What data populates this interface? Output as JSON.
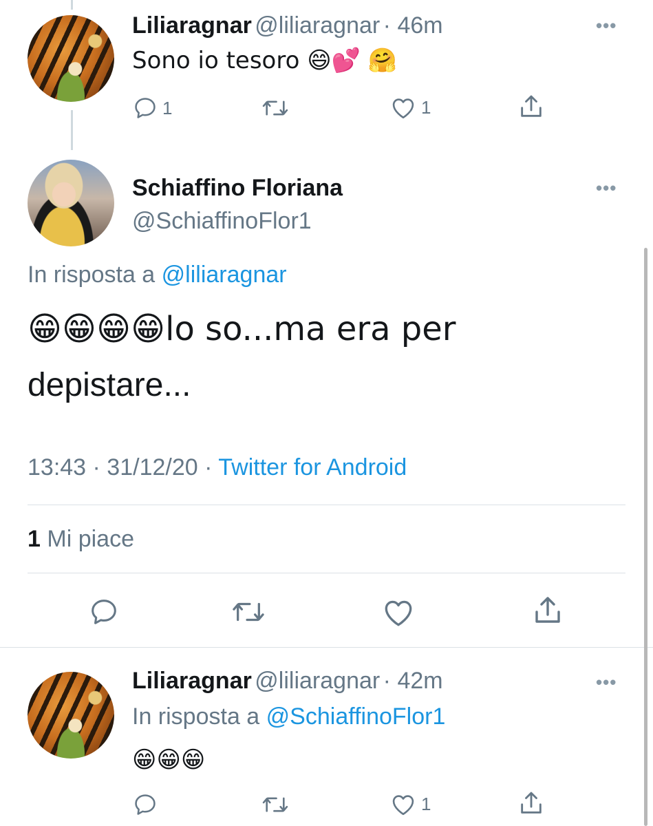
{
  "tweet1": {
    "name": "Liliaragnar",
    "handle": "@liliaragnar",
    "time": "· 46m",
    "text": "Sono io tesoro 😄💕 🤗",
    "replies": "1",
    "likes": "1"
  },
  "main": {
    "name": "Schiaffino Floriana",
    "handle": "@SchiaffinoFlor1",
    "reply_prefix": "In risposta a",
    "reply_to": "@liliaragnar",
    "text_line1": "😁😁😁😁lo so...ma era per",
    "text_line2": "depistare...",
    "time": "13:43 · 31/12/20 ·",
    "source": "Twitter for Android",
    "likes_count": "1",
    "likes_label": "Mi piace"
  },
  "tweet3": {
    "name": "Liliaragnar",
    "handle": "@liliaragnar",
    "time": "· 42m",
    "reply_prefix": "In risposta a",
    "reply_to": "@SchiaffinoFlor1",
    "text": "😁😁😁",
    "likes": "1"
  },
  "icons": {
    "reply": "reply-icon",
    "retweet": "retweet-icon",
    "like": "heart-icon",
    "share": "share-icon",
    "more": "more-icon"
  },
  "colors": {
    "link": "#1b95e0",
    "secondary": "#657786",
    "text": "#14171a",
    "divider": "#dbe1e6"
  }
}
